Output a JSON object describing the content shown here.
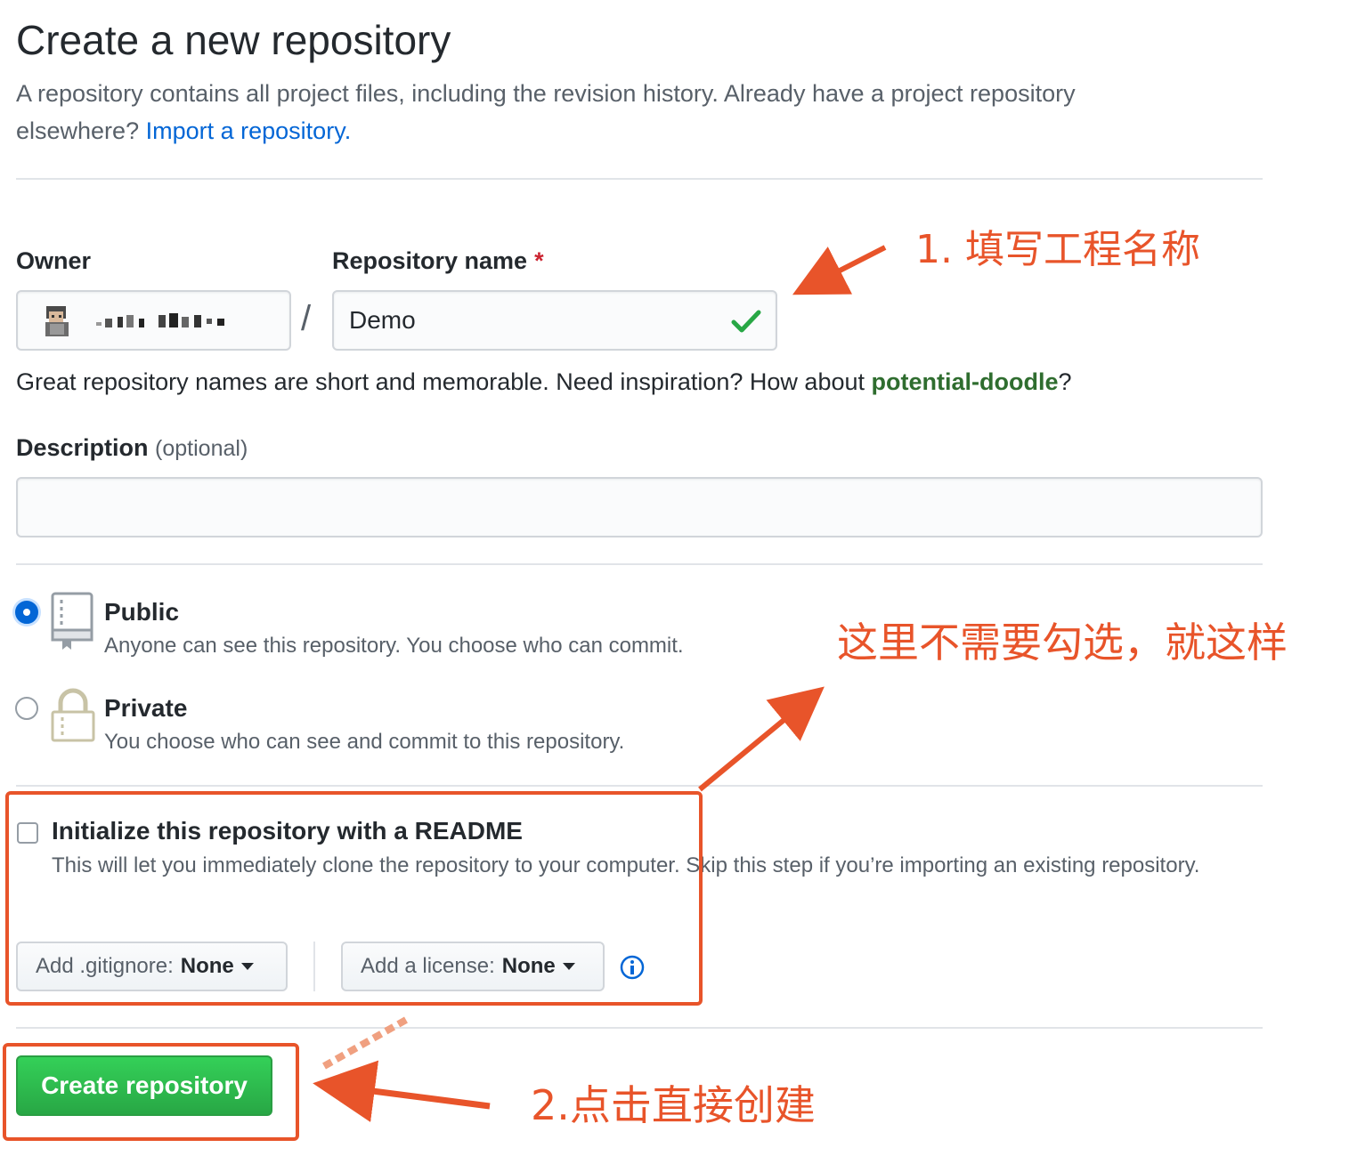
{
  "header": {
    "title": "Create a new repository",
    "lead_text": "A repository contains all project files, including the revision history. Already have a project repository elsewhere?",
    "import_link": "Import a repository."
  },
  "owner": {
    "label": "Owner"
  },
  "repo": {
    "label": "Repository name",
    "required_mark": "*",
    "value": "Demo",
    "separator": "/"
  },
  "hint": {
    "prefix": "Great repository names are short and memorable. Need inspiration? How about",
    "suggestion": "potential-doodle",
    "suffix": "?"
  },
  "description": {
    "label": "Description",
    "optional": "(optional)",
    "value": ""
  },
  "visibility": {
    "public": {
      "title": "Public",
      "desc": "Anyone can see this repository. You choose who can commit.",
      "selected": true
    },
    "private": {
      "title": "Private",
      "desc": "You choose who can see and commit to this repository.",
      "selected": false
    }
  },
  "readme": {
    "title": "Initialize this repository with a README",
    "desc": "This will let you immediately clone the repository to your computer. Skip this step if you’re importing an existing repository.",
    "checked": false
  },
  "gitignore": {
    "label": "Add .gitignore:",
    "value": "None"
  },
  "license": {
    "label": "Add a license:",
    "value": "None"
  },
  "submit": {
    "label": "Create repository"
  },
  "annotations": {
    "step1": "1. 填写工程名称",
    "note": "这里不需要勾选，就这样",
    "step2": "2.点击直接创建"
  },
  "colors": {
    "accent_blue": "#0366d6",
    "suggestion_green": "#2f6d2f",
    "button_green": "#2ea44f",
    "annotation": "#e8542a"
  }
}
